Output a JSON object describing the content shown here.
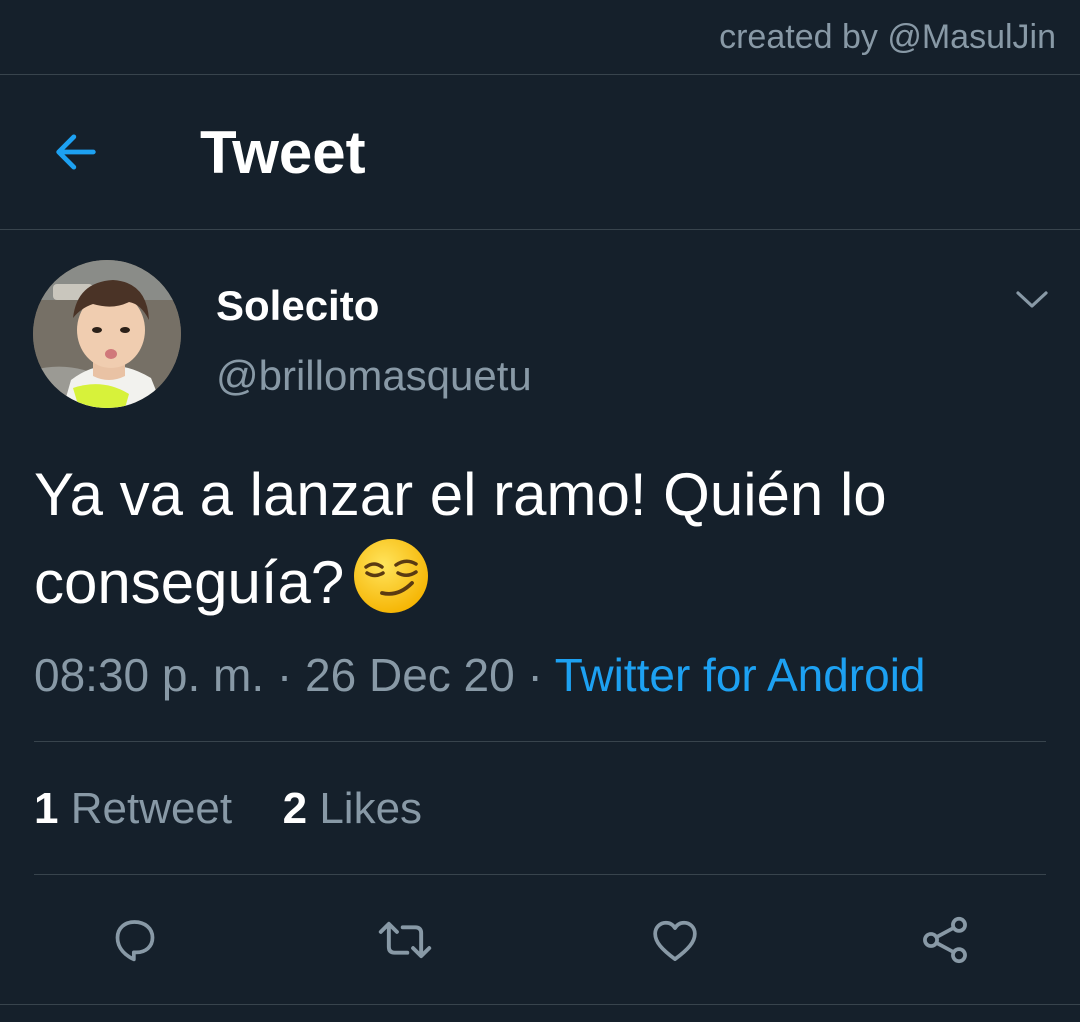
{
  "watermark": "created by @MasulJin",
  "header": {
    "title": "Tweet",
    "back_icon": "arrow-left-icon"
  },
  "author": {
    "name": "Solecito",
    "handle": "@brillomasquetu"
  },
  "tweet": {
    "text": "Ya va a lanzar el ramo! Quién lo conseguía?",
    "emoji": "smirking-face"
  },
  "meta": {
    "time": "08:30 p. m.",
    "separator1": " · ",
    "date": "26 Dec 20",
    "separator2": " · ",
    "source": "Twitter for Android"
  },
  "stats": {
    "retweets_count": "1",
    "retweets_label": "Retweet",
    "likes_count": "2",
    "likes_label": "Likes"
  },
  "actions": [
    {
      "icon": "reply-icon"
    },
    {
      "icon": "retweet-icon"
    },
    {
      "icon": "like-icon"
    },
    {
      "icon": "share-icon"
    }
  ],
  "colors": {
    "background": "#15202b",
    "accent": "#1da1f2",
    "secondary_text": "#8899a6",
    "divider": "#38444d"
  }
}
